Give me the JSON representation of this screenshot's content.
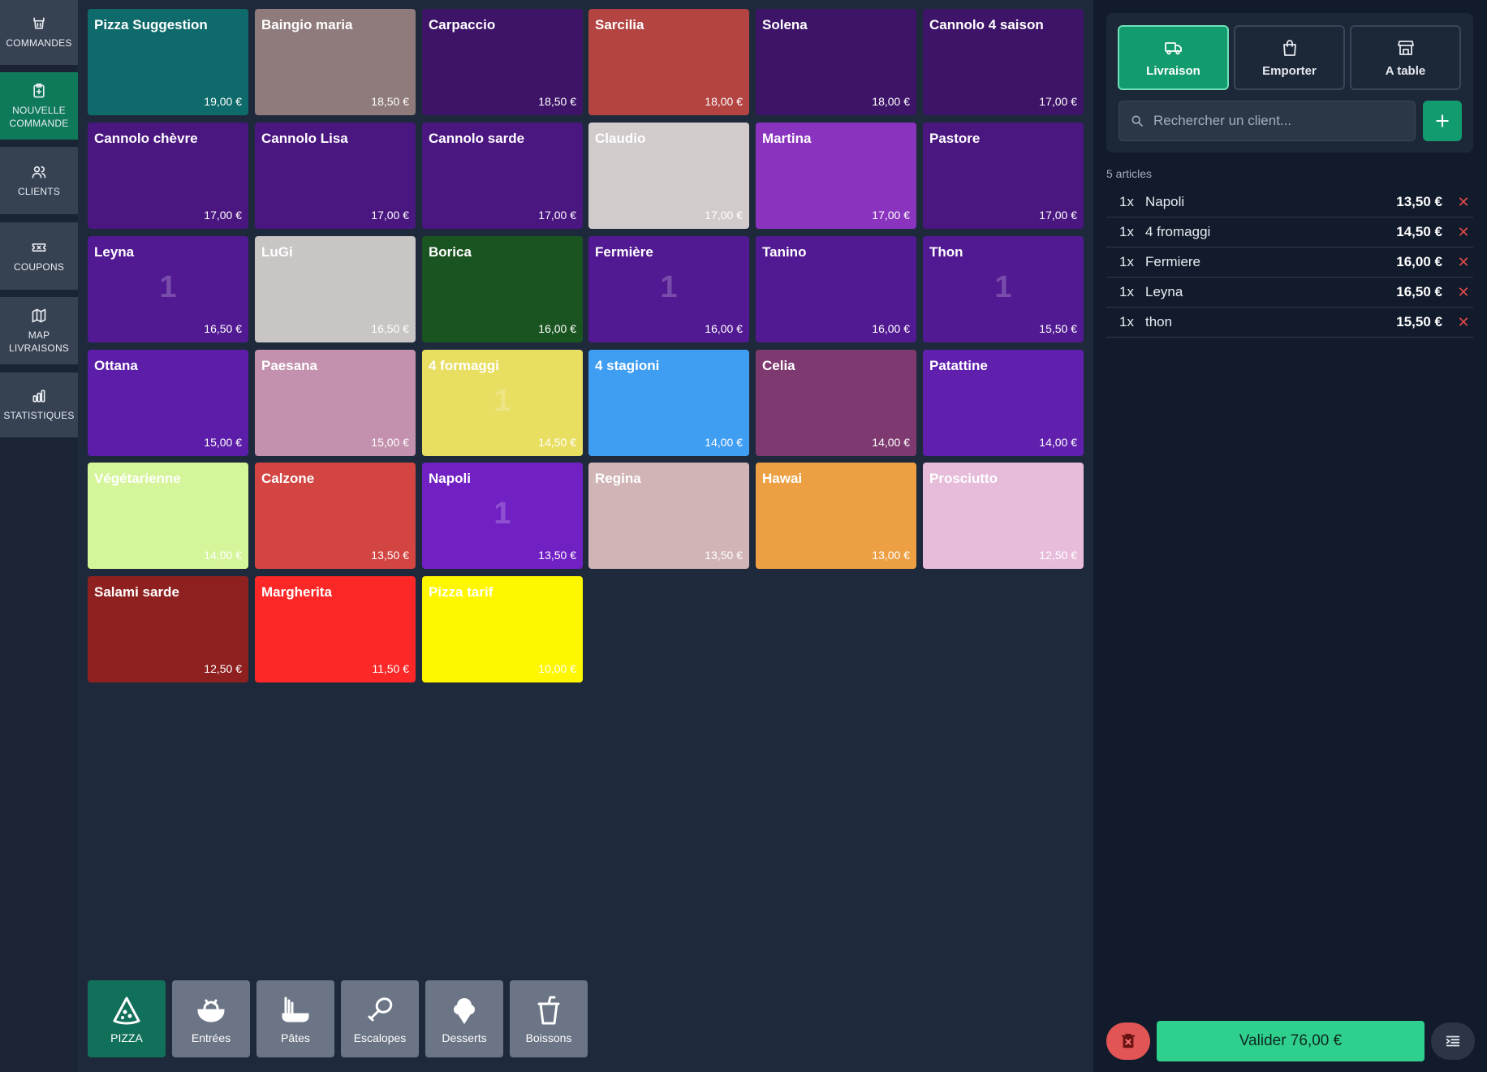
{
  "nav": {
    "items": [
      {
        "label": "COMMANDES",
        "icon": "basket-icon"
      },
      {
        "label": "NOUVELLE\nCOMMANDE",
        "icon": "clipboard-plus-icon"
      },
      {
        "label": "CLIENTS",
        "icon": "users-icon"
      },
      {
        "label": "COUPONS",
        "icon": "ticket-icon"
      },
      {
        "label": "MAP\nLIVRAISONS",
        "icon": "map-icon"
      },
      {
        "label": "STATISTIQUES",
        "icon": "bar-chart-icon"
      }
    ],
    "active_index": 1
  },
  "products": [
    {
      "name": "Pizza Suggestion",
      "price": "19,00 €",
      "color": "#0f6a6b",
      "count": ""
    },
    {
      "name": "Baingio maria",
      "price": "18,50 €",
      "color": "#8f7b7c",
      "count": ""
    },
    {
      "name": "Carpaccio",
      "price": "18,50 €",
      "color": "#3e1468",
      "count": ""
    },
    {
      "name": "Sarcilia",
      "price": "18,00 €",
      "color": "#b34441",
      "count": ""
    },
    {
      "name": "Solena",
      "price": "18,00 €",
      "color": "#3e1468",
      "count": ""
    },
    {
      "name": "Cannolo 4 saison",
      "price": "17,00 €",
      "color": "#3e1468",
      "count": ""
    },
    {
      "name": "Cannolo chèvre",
      "price": "17,00 €",
      "color": "#4a1680",
      "count": ""
    },
    {
      "name": "Cannolo Lisa",
      "price": "17,00 €",
      "color": "#4a1680",
      "count": ""
    },
    {
      "name": "Cannolo sarde",
      "price": "17,00 €",
      "color": "#4a1680",
      "count": ""
    },
    {
      "name": "Claudio",
      "price": "17,00 €",
      "color": "#d2cbcb",
      "count": ""
    },
    {
      "name": "Martina",
      "price": "17,00 €",
      "color": "#8a33bf",
      "count": ""
    },
    {
      "name": "Pastore",
      "price": "17,00 €",
      "color": "#4a1680",
      "count": ""
    },
    {
      "name": "Leyna",
      "price": "16,50 €",
      "color": "#521a92",
      "count": "1"
    },
    {
      "name": "LuGi",
      "price": "16,50 €",
      "color": "#c9c5c5",
      "count": ""
    },
    {
      "name": "Borica",
      "price": "16,00 €",
      "color": "#1a5420",
      "count": ""
    },
    {
      "name": "Fermière",
      "price": "16,00 €",
      "color": "#521a92",
      "count": "1"
    },
    {
      "name": "Tanino",
      "price": "16,00 €",
      "color": "#521a92",
      "count": ""
    },
    {
      "name": "Thon",
      "price": "15,50 €",
      "color": "#521a92",
      "count": "1"
    },
    {
      "name": "Ottana",
      "price": "15,00 €",
      "color": "#5c1da8",
      "count": ""
    },
    {
      "name": "Paesana",
      "price": "15,00 €",
      "color": "#c391ad",
      "count": ""
    },
    {
      "name": "4 formaggi",
      "price": "14,50 €",
      "color": "#e8de62",
      "count": "1"
    },
    {
      "name": "4 stagioni",
      "price": "14,00 €",
      "color": "#409ef2",
      "count": ""
    },
    {
      "name": "Celia",
      "price": "14,00 €",
      "color": "#7e3a70",
      "count": ""
    },
    {
      "name": "Patattine",
      "price": "14,00 €",
      "color": "#6020ad",
      "count": ""
    },
    {
      "name": "Végétarienne",
      "price": "14,00 €",
      "color": "#d5f59a",
      "count": ""
    },
    {
      "name": "Calzone",
      "price": "13,50 €",
      "color": "#d24542",
      "count": ""
    },
    {
      "name": "Napoli",
      "price": "13,50 €",
      "color": "#7120c4",
      "count": "1"
    },
    {
      "name": "Regina",
      "price": "13,50 €",
      "color": "#d1b4b5",
      "count": ""
    },
    {
      "name": "Hawai",
      "price": "13,00 €",
      "color": "#eda043",
      "count": ""
    },
    {
      "name": "Prosciutto",
      "price": "12,50 €",
      "color": "#e7bcda",
      "count": ""
    },
    {
      "name": "Salami sarde",
      "price": "12,50 €",
      "color": "#8f2020",
      "count": ""
    },
    {
      "name": "Margherita",
      "price": "11,50 €",
      "color": "#fc2727",
      "count": ""
    },
    {
      "name": "Pizza tarif",
      "price": "10,00 €",
      "color": "#fff700",
      "count": ""
    }
  ],
  "categories": [
    {
      "label": "PIZZA",
      "icon": "pizza-icon"
    },
    {
      "label": "Entrées",
      "icon": "salad-bowl-icon"
    },
    {
      "label": "Pâtes",
      "icon": "pasta-icon"
    },
    {
      "label": "Escalopes",
      "icon": "drumstick-icon"
    },
    {
      "label": "Desserts",
      "icon": "ice-cream-icon"
    },
    {
      "label": "Boissons",
      "icon": "cup-icon"
    }
  ],
  "order": {
    "modes": [
      {
        "label": "Livraison",
        "icon": "truck-icon"
      },
      {
        "label": "Emporter",
        "icon": "bag-icon"
      },
      {
        "label": "A table",
        "icon": "store-icon"
      }
    ],
    "active_mode": 0,
    "search_placeholder": "Rechercher un client...",
    "article_count": "5 articles",
    "items": [
      {
        "qty": "1x",
        "name": "Napoli",
        "price": "13,50 €"
      },
      {
        "qty": "1x",
        "name": "4 fromaggi",
        "price": "14,50 €"
      },
      {
        "qty": "1x",
        "name": "Fermiere",
        "price": "16,00 €"
      },
      {
        "qty": "1x",
        "name": "Leyna",
        "price": "16,50 €"
      },
      {
        "qty": "1x",
        "name": "thon",
        "price": "15,50 €"
      }
    ],
    "remove_symbol": "✕",
    "validate_label": "Valider 76,00 €"
  },
  "colors": {
    "accent": "#129b6e",
    "validate": "#2fd08e",
    "delete": "#e25555"
  }
}
